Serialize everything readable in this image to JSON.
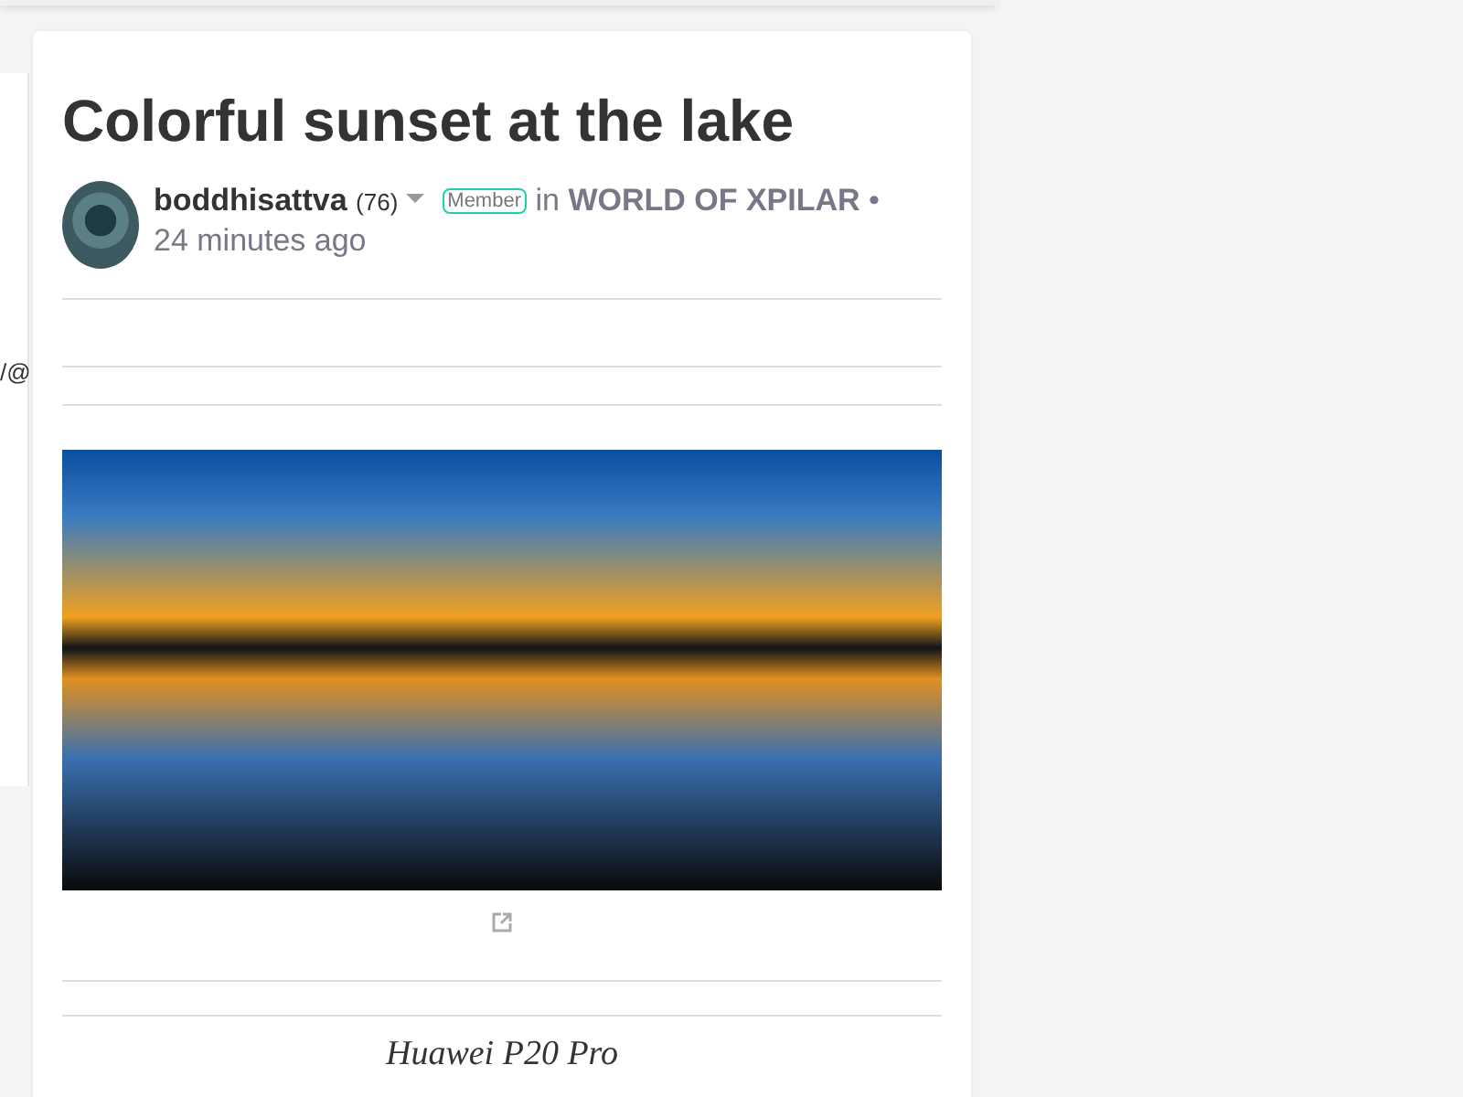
{
  "side_panel": {
    "text": "/@"
  },
  "post": {
    "title": "Colorful sunset at the lake",
    "author": {
      "name": "boddhisattva",
      "reputation": "(76)",
      "badge": "Member"
    },
    "in_label": "in",
    "community": "WORLD OF XPILAR",
    "separator": "•",
    "time": "24 minutes ago",
    "caption": "Huawei P20 Pro"
  }
}
